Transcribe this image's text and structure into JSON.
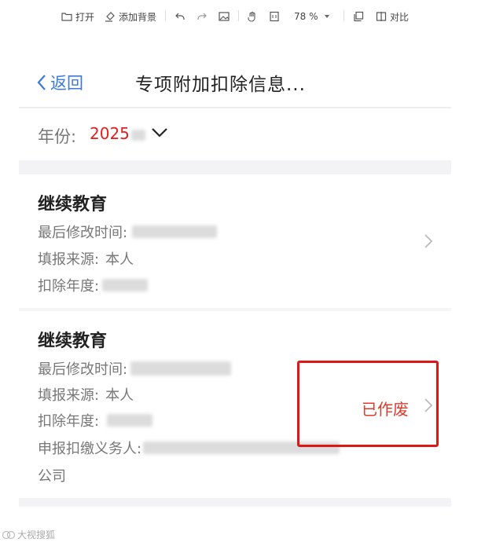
{
  "toolbar": {
    "open_label": "打开",
    "add_bg_label": "添加背景",
    "zoom": "78 %",
    "compare_label": "对比"
  },
  "nav": {
    "back_label": "返回",
    "title": "专项附加扣除信息..."
  },
  "year": {
    "label": "年份:",
    "value": "2025"
  },
  "cards": [
    {
      "title": "继续教育",
      "modified_label": "最后修改时间:",
      "source_label": "填报来源:",
      "source_value": "本人",
      "year_label": "扣除年度:",
      "status": ""
    },
    {
      "title": "继续教育",
      "modified_label": "最后修改时间:",
      "source_label": "填报来源:",
      "source_value": "本人",
      "year_label": "扣除年度:",
      "withholder_label": "申报扣缴义务人:",
      "withholder_suffix": "公司",
      "status": "已作废"
    }
  ],
  "colors": {
    "accent": "#3b7ad8",
    "highlight": "#e02020",
    "status": "#e03a2a",
    "annotation_box": "#e01515"
  },
  "watermark": {
    "text": "大视搜狐"
  }
}
